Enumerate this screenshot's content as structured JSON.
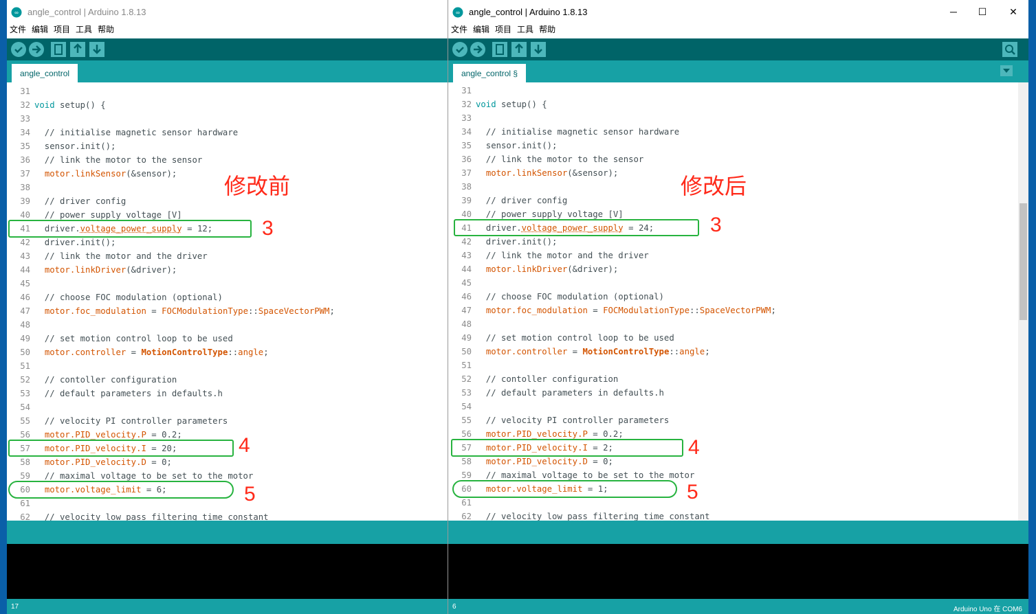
{
  "left_window": {
    "title": "angle_control | Arduino 1.8.13",
    "menu": [
      "文件",
      "编辑",
      "项目",
      "工具",
      "帮助"
    ],
    "tab_label": "angle_control",
    "annotation": "修改前",
    "status_left": "17",
    "values": {
      "l41": "12",
      "l57": "20",
      "l60": "6"
    }
  },
  "right_window": {
    "title": "angle_control | Arduino 1.8.13",
    "menu": [
      "文件",
      "编辑",
      "项目",
      "工具",
      "帮助"
    ],
    "tab_label": "angle_control §",
    "annotation": "修改后",
    "status_left": "6",
    "status_right": "Arduino Uno 在 COM6",
    "values": {
      "l41": "24",
      "l57": "2",
      "l60": "1"
    }
  },
  "window_controls": {
    "minimize": "─",
    "maximize": "☐",
    "close": "✕"
  },
  "annotation_numbers": [
    "3",
    "4",
    "5"
  ],
  "code": {
    "n31": "31",
    "n32": "32",
    "n33": "33",
    "n34": "34",
    "n35": "35",
    "n36": "36",
    "n37": "37",
    "n38": "38",
    "n39": "39",
    "n40": "40",
    "n41": "41",
    "n42": "42",
    "n43": "43",
    "n44": "44",
    "n45": "45",
    "n46": "46",
    "n47": "47",
    "n48": "48",
    "n49": "49",
    "n50": "50",
    "n51": "51",
    "n52": "52",
    "n53": "53",
    "n54": "54",
    "n55": "55",
    "n56": "56",
    "n57": "57",
    "n58": "58",
    "n59": "59",
    "n60": "60",
    "n61": "61",
    "n62": "62",
    "void": "void",
    "setup": " setup() {",
    "c34": "  // initialise magnetic sensor hardware",
    "l35": "  sensor.init();",
    "c36": "  // link the motor to the sensor",
    "motor": "motor",
    "driver": "driver",
    "linkSensor": ".linkSensor",
    "linkSensorArg": "(&sensor);",
    "c39": "  // driver config",
    "c40": "  // power supply voltage [V]",
    "vps": "voltage_power_supply",
    "l42": "  driver.init();",
    "c43": "  // link the motor and the driver",
    "linkDriver": ".linkDriver",
    "linkDriverArg": "(&driver);",
    "c46": "  // choose FOC modulation (optional)",
    "foc": ".foc_modulation",
    "eq": " = ",
    "focType": "FOCModulationType",
    "svpwm": "SpaceVectorPWM",
    "c49": "  // set motion control loop to be used",
    "controller": ".controller",
    "mct": "MotionControlType",
    "angle": "angle",
    "c52": "  // contoller configuration",
    "c53": "  // default parameters in defaults.h",
    "c55": "  // velocity PI controller parameters",
    "pid": ".PID_velocity",
    "P": ".P",
    "I": ".I",
    "D": ".D",
    "v02": "0.2",
    "v0": "0",
    "c59": "  // maximal voltage to be set to the motor",
    "vl": ".voltage_limit",
    "c62": "  // velocity low pass filtering time constant"
  }
}
